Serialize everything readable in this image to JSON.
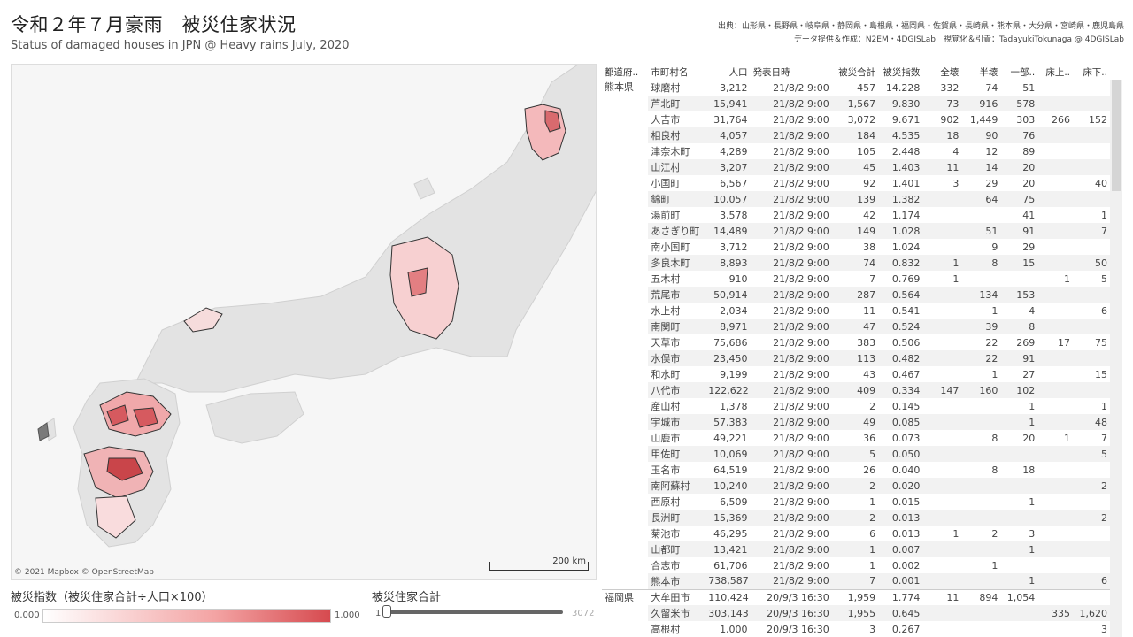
{
  "header": {
    "title": "令和２年７月豪雨　被災住家状況",
    "subtitle": "Status of damaged houses in JPN @ Heavy rains July, 2020",
    "credit_line1": "出典：山形県・長野県・岐阜県・静岡県・島根県・福岡県・佐賀県・長崎県・熊本県・大分県・宮崎県・鹿児島県",
    "credit_line2": "データ提供＆作成：N2EM・4DGISLab　視覚化＆引責：TadayukiTokunaga @ 4DGISLab"
  },
  "map": {
    "attribution": "© 2021 Mapbox  © OpenStreetMap",
    "scale_label": "200 km",
    "land_color": "#e3e3e3",
    "sea_color": "#f6f6f6",
    "damage_color_low": "#fde8e8",
    "damage_color_high": "#d64a4f"
  },
  "legend": {
    "label": "被災指数（被災住家合計÷人口×100）",
    "min": "0.000",
    "max": "1.000"
  },
  "filter": {
    "label": "被災住家合計",
    "min": "1",
    "max": "3072",
    "value": 1
  },
  "table": {
    "columns": [
      "都道府..",
      "市町村名",
      "人口",
      "発表日時",
      "被災合計",
      "被災指数",
      "全壊",
      "半壊",
      "一部..",
      "床上..",
      "床下.."
    ],
    "groups": [
      {
        "pref": "熊本県",
        "rows": [
          [
            "球磨村",
            "3,212",
            "21/8/2 9:00",
            "457",
            "14.228",
            "332",
            "74",
            "51",
            "",
            ""
          ],
          [
            "芦北町",
            "15,941",
            "21/8/2 9:00",
            "1,567",
            "9.830",
            "73",
            "916",
            "578",
            "",
            ""
          ],
          [
            "人吉市",
            "31,764",
            "21/8/2 9:00",
            "3,072",
            "9.671",
            "902",
            "1,449",
            "303",
            "266",
            "152"
          ],
          [
            "相良村",
            "4,057",
            "21/8/2 9:00",
            "184",
            "4.535",
            "18",
            "90",
            "76",
            "",
            ""
          ],
          [
            "津奈木町",
            "4,289",
            "21/8/2 9:00",
            "105",
            "2.448",
            "4",
            "12",
            "89",
            "",
            ""
          ],
          [
            "山江村",
            "3,207",
            "21/8/2 9:00",
            "45",
            "1.403",
            "11",
            "14",
            "20",
            "",
            ""
          ],
          [
            "小国町",
            "6,567",
            "21/8/2 9:00",
            "92",
            "1.401",
            "3",
            "29",
            "20",
            "",
            "40"
          ],
          [
            "錦町",
            "10,057",
            "21/8/2 9:00",
            "139",
            "1.382",
            "",
            "64",
            "75",
            "",
            ""
          ],
          [
            "湯前町",
            "3,578",
            "21/8/2 9:00",
            "42",
            "1.174",
            "",
            "",
            "41",
            "",
            "1"
          ],
          [
            "あさぎり町",
            "14,489",
            "21/8/2 9:00",
            "149",
            "1.028",
            "",
            "51",
            "91",
            "",
            "7"
          ],
          [
            "南小国町",
            "3,712",
            "21/8/2 9:00",
            "38",
            "1.024",
            "",
            "9",
            "29",
            "",
            ""
          ],
          [
            "多良木町",
            "8,893",
            "21/8/2 9:00",
            "74",
            "0.832",
            "1",
            "8",
            "15",
            "",
            "50"
          ],
          [
            "五木村",
            "910",
            "21/8/2 9:00",
            "7",
            "0.769",
            "1",
            "",
            "",
            "1",
            "5"
          ],
          [
            "荒尾市",
            "50,914",
            "21/8/2 9:00",
            "287",
            "0.564",
            "",
            "134",
            "153",
            "",
            ""
          ],
          [
            "水上村",
            "2,034",
            "21/8/2 9:00",
            "11",
            "0.541",
            "",
            "1",
            "4",
            "",
            "6"
          ],
          [
            "南関町",
            "8,971",
            "21/8/2 9:00",
            "47",
            "0.524",
            "",
            "39",
            "8",
            "",
            ""
          ],
          [
            "天草市",
            "75,686",
            "21/8/2 9:00",
            "383",
            "0.506",
            "",
            "22",
            "269",
            "17",
            "75"
          ],
          [
            "水俣市",
            "23,450",
            "21/8/2 9:00",
            "113",
            "0.482",
            "",
            "22",
            "91",
            "",
            ""
          ],
          [
            "和水町",
            "9,199",
            "21/8/2 9:00",
            "43",
            "0.467",
            "",
            "1",
            "27",
            "",
            "15"
          ],
          [
            "八代市",
            "122,622",
            "21/8/2 9:00",
            "409",
            "0.334",
            "147",
            "160",
            "102",
            "",
            ""
          ],
          [
            "産山村",
            "1,378",
            "21/8/2 9:00",
            "2",
            "0.145",
            "",
            "",
            "1",
            "",
            "1"
          ],
          [
            "宇城市",
            "57,383",
            "21/8/2 9:00",
            "49",
            "0.085",
            "",
            "",
            "1",
            "",
            "48"
          ],
          [
            "山鹿市",
            "49,221",
            "21/8/2 9:00",
            "36",
            "0.073",
            "",
            "8",
            "20",
            "1",
            "7"
          ],
          [
            "甲佐町",
            "10,069",
            "21/8/2 9:00",
            "5",
            "0.050",
            "",
            "",
            "",
            "",
            "5"
          ],
          [
            "玉名市",
            "64,519",
            "21/8/2 9:00",
            "26",
            "0.040",
            "",
            "8",
            "18",
            "",
            ""
          ],
          [
            "南阿蘇村",
            "10,240",
            "21/8/2 9:00",
            "2",
            "0.020",
            "",
            "",
            "",
            "",
            "2"
          ],
          [
            "西原村",
            "6,509",
            "21/8/2 9:00",
            "1",
            "0.015",
            "",
            "",
            "1",
            "",
            ""
          ],
          [
            "長洲町",
            "15,369",
            "21/8/2 9:00",
            "2",
            "0.013",
            "",
            "",
            "",
            "",
            "2"
          ],
          [
            "菊池市",
            "46,295",
            "21/8/2 9:00",
            "6",
            "0.013",
            "1",
            "2",
            "3",
            "",
            ""
          ],
          [
            "山都町",
            "13,421",
            "21/8/2 9:00",
            "1",
            "0.007",
            "",
            "",
            "1",
            "",
            ""
          ],
          [
            "合志市",
            "61,706",
            "21/8/2 9:00",
            "1",
            "0.002",
            "",
            "1",
            "",
            "",
            ""
          ],
          [
            "熊本市",
            "738,587",
            "21/8/2 9:00",
            "7",
            "0.001",
            "",
            "",
            "1",
            "",
            "6"
          ]
        ]
      },
      {
        "pref": "福岡県",
        "rows": [
          [
            "大牟田市",
            "110,424",
            "20/9/3 16:30",
            "1,959",
            "1.774",
            "11",
            "894",
            "1,054",
            "",
            ""
          ],
          [
            "久留米市",
            "303,143",
            "20/9/3 16:30",
            "1,955",
            "0.645",
            "",
            "",
            "",
            "335",
            "1,620"
          ],
          [
            "高根村",
            "1,000",
            "20/9/3 16:30",
            "3",
            "0.267",
            "",
            "",
            "",
            "",
            "3"
          ]
        ]
      }
    ]
  }
}
